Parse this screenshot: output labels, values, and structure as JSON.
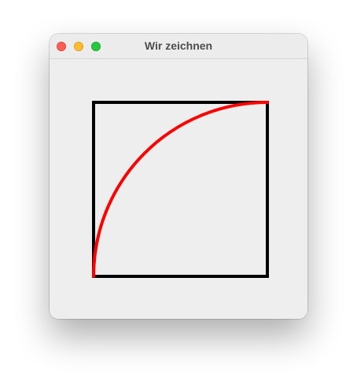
{
  "window": {
    "title": "Wir zeichnen"
  },
  "drawing": {
    "shapes": [
      {
        "kind": "square-outline",
        "color": "#000000"
      },
      {
        "kind": "quarter-arc",
        "from": "bottom-left",
        "to": "top-right",
        "color": "#ff0000"
      }
    ]
  },
  "colors": {
    "close": "#fe5f57",
    "minimize": "#febc2e",
    "zoom": "#28c840"
  }
}
